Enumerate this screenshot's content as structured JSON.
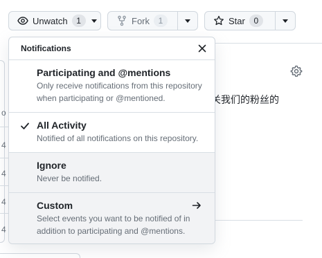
{
  "actions": {
    "watch": {
      "label": "Unwatch",
      "count": "1"
    },
    "fork": {
      "label": "Fork",
      "count": "1"
    },
    "star": {
      "label": "Star",
      "count": "0"
    }
  },
  "background": {
    "cn_text": "关我们的粉丝的",
    "left_chars": [
      "o",
      "4",
      "4",
      "4",
      "4"
    ]
  },
  "notifications": {
    "title": "Notifications",
    "options": [
      {
        "title": "Participating and @mentions",
        "desc_line1": "Only receive notifications from this repository",
        "desc_line2": "when participating or @mentioned."
      },
      {
        "title": "All Activity",
        "desc_line1": "Notified of all notifications on this repository.",
        "selected": true
      },
      {
        "title": "Ignore",
        "desc_line1": "Never be notified."
      },
      {
        "title": "Custom",
        "desc_line1": "Select events you want to be notified of in",
        "desc_line2": "addition to participating and @mentions."
      }
    ]
  },
  "colors": {
    "border": "#d0d7de",
    "button_bg": "#f6f8fa",
    "muted_text": "#656d76",
    "hover_bg": "#f2f3f5"
  }
}
